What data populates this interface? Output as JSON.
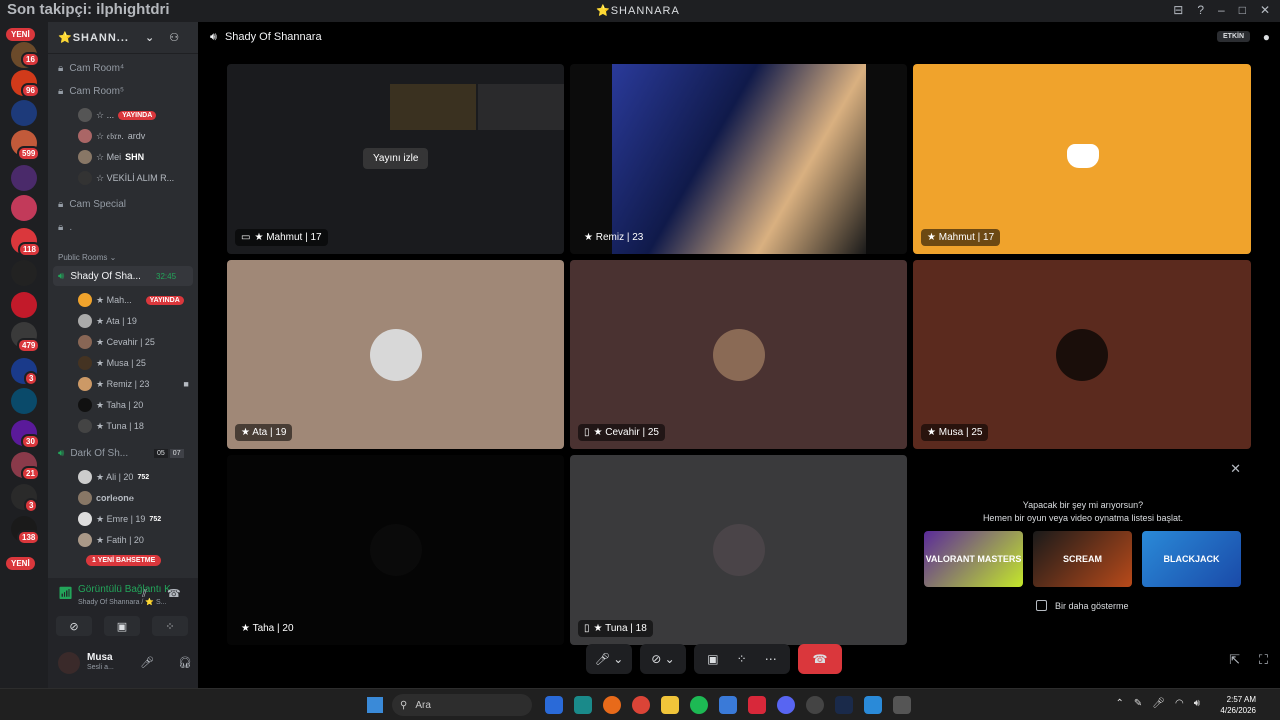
{
  "overlay": {
    "text": "Son takipçi: ilphightdri"
  },
  "window": {
    "title": "⭐SHANNARA",
    "controls": [
      "⊟",
      "?",
      "–",
      "□",
      "✕"
    ]
  },
  "servers": {
    "yeni_top": "YENİ",
    "yeni_bottom": "YENİ",
    "badges": [
      "16",
      "96",
      "599",
      "118",
      "479",
      "3",
      "30",
      "21",
      "3",
      "138"
    ]
  },
  "guild": {
    "name": "⭐SHANN...",
    "chevron": "⌄"
  },
  "channels": {
    "cam4": "Cam Room⁴",
    "cam5": "Cam Room⁵",
    "cam5_members": [
      {
        "name": "☆ ...",
        "badge": "YAYINDA"
      },
      {
        "name": "☆ 𝔢𝔟𝔯𝔳.",
        "tag": "ardv"
      },
      {
        "name": "☆ Mei",
        "tag": "SHN"
      },
      {
        "name": "☆ VEKİLİ ALIM R..."
      }
    ],
    "cam_special": "Cam Special",
    "dot": ".",
    "public_rooms": "Public Rooms ⌄",
    "active_room": "Shady Of Sha...",
    "active_time": "32:45",
    "active_members": [
      {
        "name": "★ Mah...",
        "badge": "YAYINDA"
      },
      {
        "name": "★ Ata | 19"
      },
      {
        "name": "★ Cevahir | 25"
      },
      {
        "name": "★ Musa | 25"
      },
      {
        "name": "★ Remiz | 23"
      },
      {
        "name": "★ Taha | 20"
      },
      {
        "name": "★ Tuna | 18"
      }
    ],
    "dark_room": "Dark Of Sh...",
    "dark_counts": [
      "05",
      "07"
    ],
    "dark_members": [
      {
        "name": "★ Ali | 20",
        "tag": "752"
      },
      {
        "name": "𝐜𝐨𝐫𝐥𝐞𝐨𝐧𝐞"
      },
      {
        "name": "★ Emre | 19",
        "tag": "752"
      },
      {
        "name": "★ Fatih | 20"
      }
    ],
    "new_mention": "1 YENİ BAHSETME"
  },
  "voice": {
    "status": "Görüntülü Bağlantı K",
    "channel": "Shady Of Shannara / ⭐ S..."
  },
  "user": {
    "name": "Musa",
    "status": "Sesli a..."
  },
  "call": {
    "channel_title": "Shady Of Shannara",
    "etkin": "ETKİN",
    "watch_stream": "Yayını izle",
    "tiles": [
      {
        "label": "★ Mahmut | 17",
        "color": "#1a1b1e"
      },
      {
        "label": "★ Remiz | 23",
        "color": "#0c0c0c"
      },
      {
        "label": "★ Mahmut | 17",
        "color": "#f0a32c"
      },
      {
        "label": "★ Ata | 19",
        "color": "#a08877"
      },
      {
        "label": "★ Cevahir | 25",
        "color": "#4a3231"
      },
      {
        "label": "★ Musa | 25",
        "color": "#5b2a1e"
      },
      {
        "label": "★ Taha | 20",
        "color": "#050505"
      },
      {
        "label": "★ Tuna | 18",
        "color": "#3a3a3c"
      }
    ]
  },
  "suggestion": {
    "line1": "Yapacak bir şey mi arıyorsun?",
    "line2": "Hemen bir oyun veya video oynatma listesi başlat.",
    "cards": [
      "VALORANT MASTERS",
      "SCREAM",
      "BLACKJACK"
    ],
    "dont_show": "Bir daha gösterme"
  },
  "taskbar": {
    "search": "Ara",
    "time": "2:57 AM",
    "date": "4/26/2026"
  },
  "colors": {
    "accent": "#5865f2",
    "danger": "#da373c",
    "online": "#23a55a"
  }
}
